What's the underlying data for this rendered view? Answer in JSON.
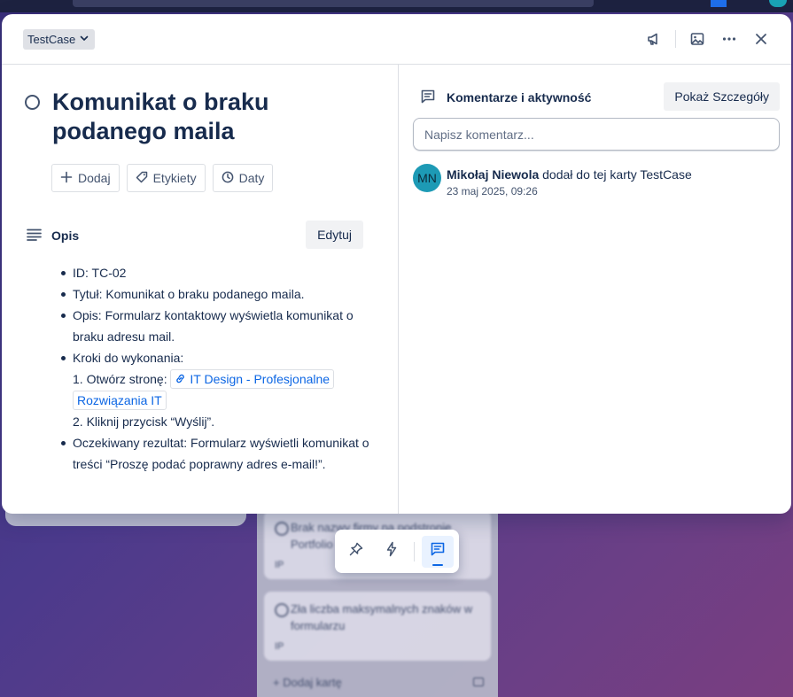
{
  "background": {
    "cards": [
      {
        "title": "Brak nazwy firmy na podstronie Portfolio",
        "icon": "IP"
      },
      {
        "title": "Zła liczba maksymalnych znaków w formularzu",
        "icon": "IP"
      }
    ],
    "add_card_label": "Dodaj kartę"
  },
  "modal": {
    "list_name": "TestCase",
    "title": "Komunikat o braku podanego maila",
    "actions": {
      "add": "Dodaj",
      "labels": "Etykiety",
      "dates": "Daty"
    },
    "description": {
      "heading": "Opis",
      "edit_label": "Edytuj",
      "items": {
        "id": "ID: TC-02",
        "title": "Tytuł: Komunikat o braku podanego maila.",
        "desc": "Opis: Formularz kontaktowy wyświetla komunikat o braku adresu mail.",
        "steps_heading": "Kroki do wykonania:",
        "step1_prefix": "1. Otwórz stronę:",
        "step1_link": "IT Design - Profesjonalne Rozwiązania IT",
        "step2": "2. Kliknij przycisk “Wyślij”.",
        "expected": "Oczekiwany rezultat: Formularz wyświetli komunikat o treści “Proszę podać poprawny adres e-mail!”."
      }
    },
    "comments": {
      "heading": "Komentarze i aktywność",
      "show_details_label": "Pokaż Szczegóły",
      "input_placeholder": "Napisz komentarz...",
      "activity": [
        {
          "initials": "MN",
          "user": "Mikołaj Niewola",
          "action": " dodał do tej karty TestCase",
          "time": "23 maj 2025, 09:26"
        }
      ]
    }
  },
  "colors": {
    "accent": "#0c66e4",
    "avatar_bg": "#1d9ab5"
  }
}
